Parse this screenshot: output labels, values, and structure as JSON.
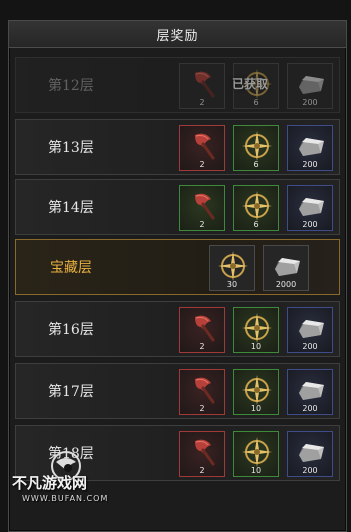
{
  "panel": {
    "title": "层奖励",
    "claimed_text": "已获取"
  },
  "rows": [
    {
      "label": "第12层",
      "state": "claimed",
      "items": [
        {
          "icon": "axe-icon",
          "rarity": "gray",
          "count": "2"
        },
        {
          "icon": "compass-emblem-icon",
          "rarity": "gray",
          "count": "6"
        },
        {
          "icon": "ingot-icon",
          "rarity": "gray",
          "count": "200"
        }
      ]
    },
    {
      "label": "第13层",
      "state": "normal",
      "items": [
        {
          "icon": "axe-icon",
          "rarity": "red",
          "count": "2"
        },
        {
          "icon": "compass-emblem-icon",
          "rarity": "green",
          "count": "6"
        },
        {
          "icon": "ingot-icon",
          "rarity": "blue",
          "count": "200"
        }
      ]
    },
    {
      "label": "第14层",
      "state": "normal",
      "items": [
        {
          "icon": "axe-icon",
          "rarity": "green",
          "count": "2"
        },
        {
          "icon": "compass-emblem-icon",
          "rarity": "green",
          "count": "6"
        },
        {
          "icon": "ingot-icon",
          "rarity": "blue",
          "count": "200"
        }
      ]
    },
    {
      "label": "宝藏层",
      "state": "special",
      "items": [
        {
          "icon": "compass-emblem-icon",
          "rarity": "gray",
          "count": "30"
        },
        {
          "icon": "ingot-icon",
          "rarity": "gray",
          "count": "2000"
        }
      ]
    },
    {
      "label": "第16层",
      "state": "normal",
      "items": [
        {
          "icon": "axe-icon",
          "rarity": "red",
          "count": "2"
        },
        {
          "icon": "compass-emblem-icon",
          "rarity": "green",
          "count": "10"
        },
        {
          "icon": "ingot-icon",
          "rarity": "blue",
          "count": "200"
        }
      ]
    },
    {
      "label": "第17层",
      "state": "normal",
      "items": [
        {
          "icon": "axe-icon",
          "rarity": "red",
          "count": "2"
        },
        {
          "icon": "compass-emblem-icon",
          "rarity": "green",
          "count": "10"
        },
        {
          "icon": "ingot-icon",
          "rarity": "blue",
          "count": "200"
        }
      ]
    },
    {
      "label": "第18层",
      "state": "normal",
      "items": [
        {
          "icon": "axe-icon",
          "rarity": "red",
          "count": "2"
        },
        {
          "icon": "compass-emblem-icon",
          "rarity": "green",
          "count": "10"
        },
        {
          "icon": "ingot-icon",
          "rarity": "blue",
          "count": "200"
        }
      ]
    }
  ],
  "watermark": {
    "name": "不凡游戏网",
    "url": "WWW.BUFAN.COM"
  },
  "colors": {
    "special_accent": "#e8b040",
    "rarity_red": "#a03a3a",
    "rarity_green": "#3f8a3a",
    "rarity_blue": "#3e4d8a"
  }
}
